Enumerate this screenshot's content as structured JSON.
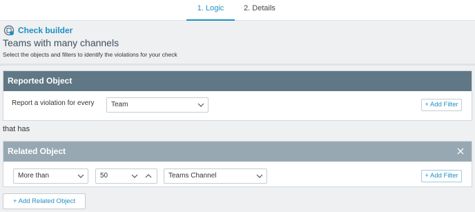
{
  "tabs": [
    {
      "label": "1. Logic",
      "active": true
    },
    {
      "label": "2. Details",
      "active": false
    }
  ],
  "header": {
    "builder_link": "Check builder",
    "title": "Teams with many channels",
    "subtitle": "Select the objects and filters to identify the violations for your check"
  },
  "reported": {
    "heading": "Reported Object",
    "prompt": "Report a violation for every",
    "object_value": "Team",
    "add_filter": "+ Add Filter"
  },
  "connector": "that has",
  "related": {
    "heading": "Related Object",
    "comparison_value": "More than",
    "count_value": "50",
    "object_value": "Teams Channel",
    "add_filter": "+ Add Filter"
  },
  "add_related": "+ Add Related Object",
  "colors": {
    "accent": "#1f8fc4",
    "reported_header": "#607785",
    "related_header": "#97a8b2",
    "background": "#eef0f2"
  },
  "icons": {
    "builder": "check-builder-icon",
    "dropdown": "chevron-down-icon",
    "increment": "chevron-up-icon",
    "close": "close-icon"
  }
}
